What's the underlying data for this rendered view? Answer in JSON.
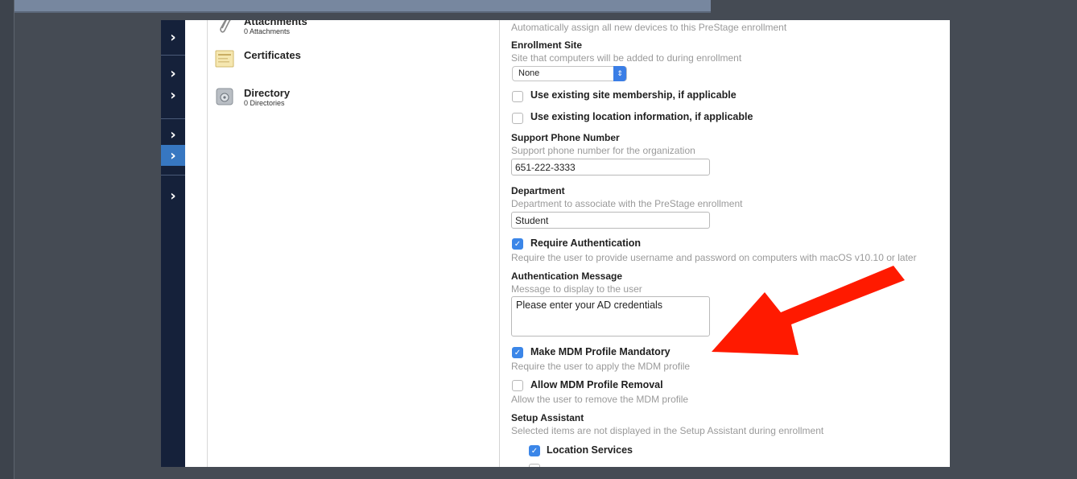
{
  "sidebar": {
    "chevron": "›"
  },
  "left_panel": {
    "items": [
      {
        "title": "Attachments",
        "subtitle": "0 Attachments",
        "icon": "paperclip-icon"
      },
      {
        "title": "Certificates",
        "subtitle": "",
        "icon": "certificate-icon"
      },
      {
        "title": "Directory",
        "subtitle": "0 Directories",
        "icon": "directory-icon"
      }
    ]
  },
  "form": {
    "auto_assign_hint": "Automatically assign all new devices to this PreStage enrollment",
    "enrollment_site": {
      "label": "Enrollment Site",
      "hint": "Site that computers will be added to during enrollment",
      "selected": "None"
    },
    "use_existing_site": {
      "label": "Use existing site membership, if applicable",
      "checked": false
    },
    "use_existing_location": {
      "label": "Use existing location information, if applicable",
      "checked": false
    },
    "support_phone": {
      "label": "Support Phone Number",
      "hint": "Support phone number for the organization",
      "value": "651-222-3333"
    },
    "department": {
      "label": "Department",
      "hint": "Department to associate with the PreStage enrollment",
      "value": "Student"
    },
    "require_auth": {
      "label": "Require Authentication",
      "hint": "Require the user to provide username and password on computers with macOS v10.10 or later",
      "checked": true
    },
    "auth_message": {
      "label": "Authentication Message",
      "hint": "Message to display to the user",
      "value": "Please enter your AD credentials"
    },
    "mdm_mandatory": {
      "label": "Make MDM Profile Mandatory",
      "hint": "Require the user to apply the MDM profile",
      "checked": true
    },
    "mdm_removal": {
      "label": "Allow MDM Profile Removal",
      "hint": "Allow the user to remove the MDM profile",
      "checked": false
    },
    "setup_assistant": {
      "label": "Setup Assistant",
      "hint": "Selected items are not displayed in the Setup Assistant during enrollment",
      "items": [
        {
          "label": "Location Services",
          "checked": true
        }
      ]
    }
  },
  "colors": {
    "sidebar_bg": "#15213a",
    "sidebar_active": "#3777c1",
    "checkbox_checked": "#3b86e8",
    "annotation_arrow": "#ff1a00",
    "backdrop": "#454b54"
  }
}
